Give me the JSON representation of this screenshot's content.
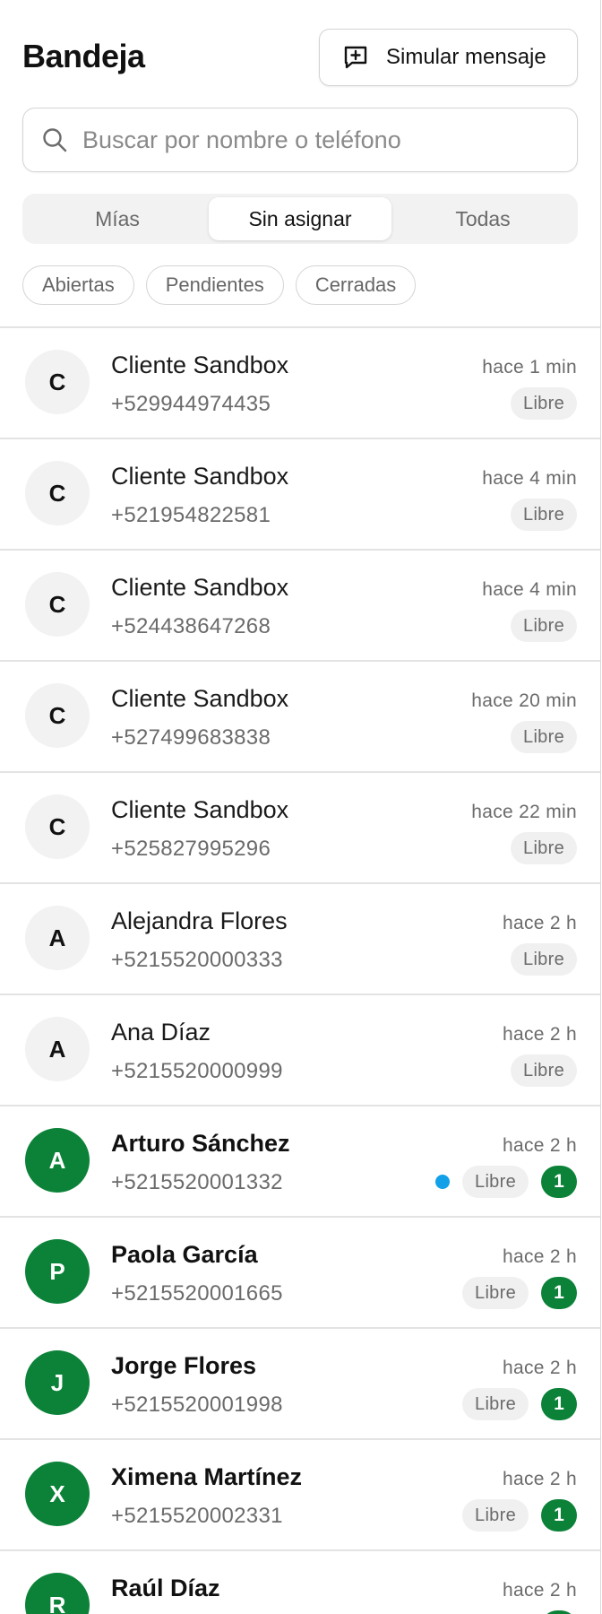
{
  "header": {
    "title": "Bandeja",
    "simulate_label": "Simular mensaje",
    "simulate_icon": "message-plus-icon"
  },
  "search": {
    "placeholder": "Buscar por nombre o teléfono",
    "value": "",
    "icon": "search-icon"
  },
  "tabs": [
    {
      "label": "Mías",
      "active": false
    },
    {
      "label": "Sin asignar",
      "active": true
    },
    {
      "label": "Todas",
      "active": false
    }
  ],
  "filters": [
    {
      "label": "Abiertas"
    },
    {
      "label": "Pendientes"
    },
    {
      "label": "Cerradas"
    }
  ],
  "colors": {
    "accent_green": "#0b8238",
    "unread_dot": "#12a0e8"
  },
  "conversations": [
    {
      "initial": "C",
      "name": "Cliente Sandbox",
      "phone": "+529944974435",
      "time": "hace 1 min",
      "status": "Libre",
      "highlight": false,
      "unread_dot": false,
      "count": ""
    },
    {
      "initial": "C",
      "name": "Cliente Sandbox",
      "phone": "+521954822581",
      "time": "hace 4 min",
      "status": "Libre",
      "highlight": false,
      "unread_dot": false,
      "count": ""
    },
    {
      "initial": "C",
      "name": "Cliente Sandbox",
      "phone": "+524438647268",
      "time": "hace 4 min",
      "status": "Libre",
      "highlight": false,
      "unread_dot": false,
      "count": ""
    },
    {
      "initial": "C",
      "name": "Cliente Sandbox",
      "phone": "+527499683838",
      "time": "hace 20 min",
      "status": "Libre",
      "highlight": false,
      "unread_dot": false,
      "count": ""
    },
    {
      "initial": "C",
      "name": "Cliente Sandbox",
      "phone": "+525827995296",
      "time": "hace 22 min",
      "status": "Libre",
      "highlight": false,
      "unread_dot": false,
      "count": ""
    },
    {
      "initial": "A",
      "name": "Alejandra Flores",
      "phone": "+5215520000333",
      "time": "hace 2 h",
      "status": "Libre",
      "highlight": false,
      "unread_dot": false,
      "count": ""
    },
    {
      "initial": "A",
      "name": "Ana Díaz",
      "phone": "+5215520000999",
      "time": "hace 2 h",
      "status": "Libre",
      "highlight": false,
      "unread_dot": false,
      "count": ""
    },
    {
      "initial": "A",
      "name": "Arturo Sánchez",
      "phone": "+5215520001332",
      "time": "hace 2 h",
      "status": "Libre",
      "highlight": true,
      "unread_dot": true,
      "count": "1"
    },
    {
      "initial": "P",
      "name": "Paola García",
      "phone": "+5215520001665",
      "time": "hace 2 h",
      "status": "Libre",
      "highlight": true,
      "unread_dot": false,
      "count": "1"
    },
    {
      "initial": "J",
      "name": "Jorge Flores",
      "phone": "+5215520001998",
      "time": "hace 2 h",
      "status": "Libre",
      "highlight": true,
      "unread_dot": false,
      "count": "1"
    },
    {
      "initial": "X",
      "name": "Ximena Martínez",
      "phone": "+5215520002331",
      "time": "hace 2 h",
      "status": "Libre",
      "highlight": true,
      "unread_dot": false,
      "count": "1"
    },
    {
      "initial": "R",
      "name": "Raúl Díaz",
      "phone": "",
      "time": "hace 2 h",
      "status": "",
      "highlight": true,
      "unread_dot": false,
      "count": "1"
    }
  ]
}
